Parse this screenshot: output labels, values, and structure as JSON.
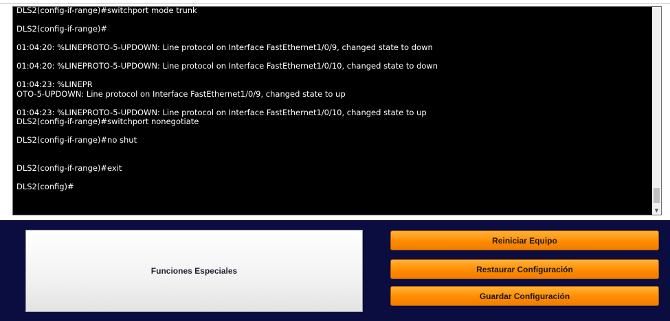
{
  "terminal": {
    "lines": [
      "DLS2(config-if-range)#switchport mode trunk",
      "",
      "DLS2(config-if-range)#",
      "",
      "01:04:20: %LINEPROTO-5-UPDOWN: Line protocol on Interface FastEthernet1/0/9, changed state to down",
      "",
      "01:04:20: %LINEPROTO-5-UPDOWN: Line protocol on Interface FastEthernet1/0/10, changed state to down",
      "",
      "01:04:23: %LINEPR",
      "OTO-5-UPDOWN: Line protocol on Interface FastEthernet1/0/9, changed state to up",
      "",
      "01:04:23: %LINEPROTO-5-UPDOWN: Line protocol on Interface FastEthernet1/0/10, changed state to up",
      "DLS2(config-if-range)#switchport nonegotiate",
      "",
      "DLS2(config-if-range)#no shut",
      "",
      "",
      "DLS2(config-if-range)#exit",
      "",
      "DLS2(config)#"
    ]
  },
  "panel": {
    "funciones_label": "Funciones Especiales",
    "buttons": {
      "reiniciar": "Reiniciar Equipo",
      "restaurar": "Restaurar Configuración",
      "guardar": "Guardar Configuración"
    }
  },
  "colors": {
    "terminal_bg": "#000000",
    "panel_bg": "#0b0c40",
    "button_orange": "#ff8c00"
  },
  "icons": {
    "scroll_down": "chevron-down-icon"
  }
}
